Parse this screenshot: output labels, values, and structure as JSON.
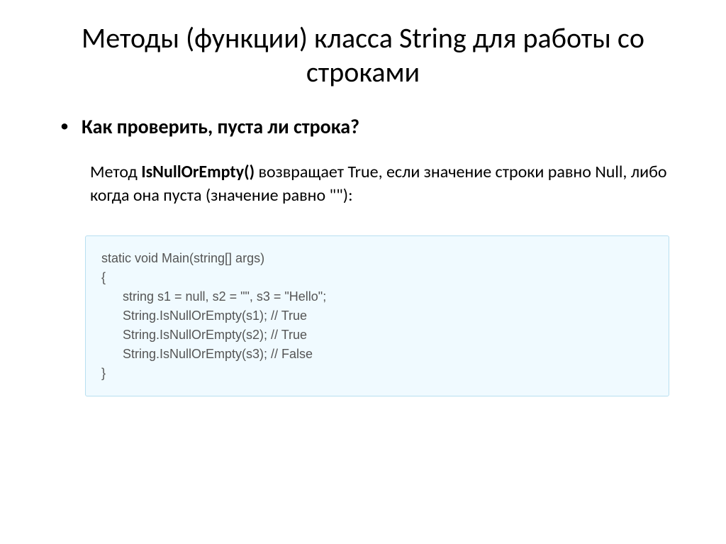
{
  "title": "Методы (функции) класса String для работы со строками",
  "bullet": {
    "marker": "•",
    "heading": "Как проверить, пуста ли строка?"
  },
  "description": {
    "prefix": "Метод ",
    "method": "IsNullOrEmpty()",
    "suffix": " возвращает True, если значение строки равно Null, либо когда она пуста (значение равно \"\"):"
  },
  "code": {
    "line1": "static void Main(string[] args)",
    "line2": "{",
    "line3": "string s1 = null, s2 = \"\", s3 = \"Hello\";",
    "line4": "String.IsNullOrEmpty(s1); // True",
    "line5": "String.IsNullOrEmpty(s2); // True",
    "line6": "String.IsNullOrEmpty(s3); // False",
    "line7": "}"
  }
}
